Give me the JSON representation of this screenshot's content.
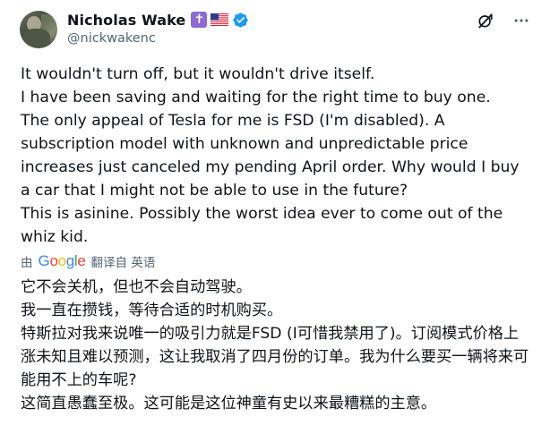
{
  "author": {
    "display_name": "Nicholas Wake",
    "handle": "@nickwakenc",
    "badges": [
      "cross-badge",
      "us-flag-icon",
      "verified-icon"
    ],
    "cross_glyph": "✝"
  },
  "actions": {
    "icons": [
      "grok-icon",
      "more-icon"
    ]
  },
  "tweet": {
    "lines": [
      "It wouldn't turn off, but it wouldn't drive itself.",
      "I have been saving and waiting for the right time to buy one.",
      "The only appeal of Tesla for me is FSD (I'm disabled). A subscription model with unknown and unpredictable price increases just canceled my pending April order. Why would I buy a car that I might not be able to use in the future?",
      "This is asinine. Possibly the worst idea ever to come out of the whiz kid."
    ]
  },
  "translation_bar": {
    "prefix": "由",
    "provider": "Google",
    "suffix": "翻译自 英语"
  },
  "translation": {
    "lines": [
      "它不会关机，但也不会自动驾驶。",
      "我一直在攒钱，等待合适的时机购买。",
      "特斯拉对我来说唯一的吸引力就是FSD (I可惜我禁用了)。订阅模式价格上涨未知且难以预测，这让我取消了四月份的订单。我为什么要买一辆将来可能用不上的车呢?",
      "这简直愚蠢至极。这可能是这位神童有史以来最糟糕的主意。"
    ]
  },
  "colors": {
    "text": "#0f1419",
    "secondary": "#536471",
    "verified": "#1d9bf0",
    "cross_badge": "#8e6bd1"
  }
}
